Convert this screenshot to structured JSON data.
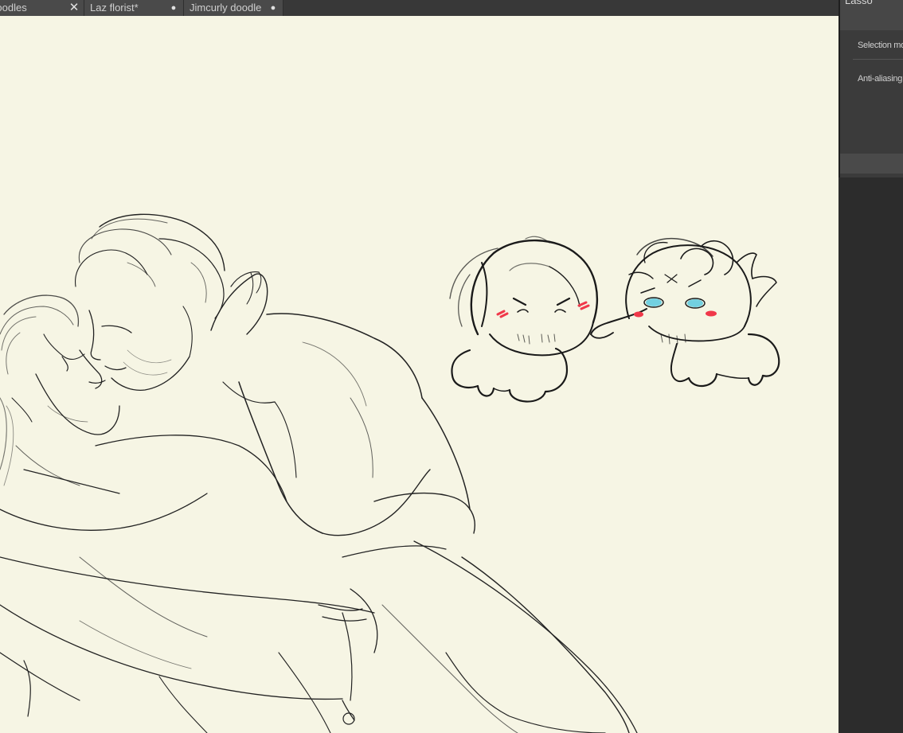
{
  "tabs": [
    {
      "label": "Doodles",
      "control": "✕"
    },
    {
      "label": "Laz florist*",
      "control": "●"
    },
    {
      "label": "Jimcurly doodle",
      "control": "●"
    }
  ],
  "tool_panel": {
    "title": "Lasso",
    "selection_mode_label": "Selection mode",
    "anti_aliasing_label": "Anti-aliasing"
  },
  "colors": {
    "canvas": "#f6f5e4",
    "ink": "#1c1c1c",
    "blush": "#f0384a",
    "eye_blue": "#72d0e0"
  }
}
